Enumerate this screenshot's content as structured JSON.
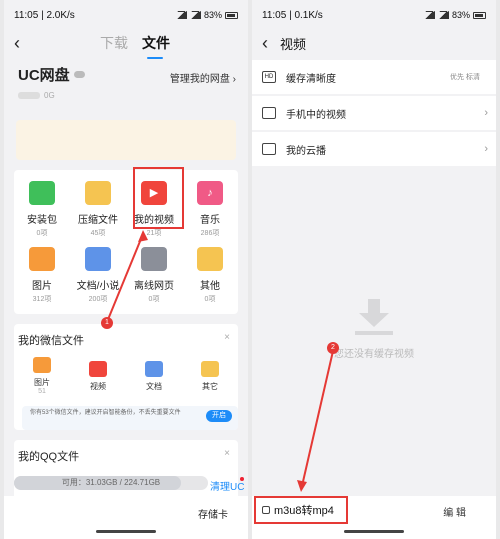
{
  "left": {
    "status": {
      "time": "11:05",
      "speed": "2.0K/s",
      "battery": "83%"
    },
    "tabs": {
      "download": "下载",
      "file": "文件"
    },
    "disk": {
      "title": "UC网盘",
      "used": "0G",
      "manage": "管理我的网盘"
    },
    "files": [
      {
        "label": "安装包",
        "count": "0项",
        "icon": "android-icon",
        "color": "#3fbf5a"
      },
      {
        "label": "压缩文件",
        "count": "45项",
        "icon": "zip-icon",
        "color": "#f5c451"
      },
      {
        "label": "我的视频",
        "count": "21项",
        "icon": "video-icon",
        "color": "#f0453c"
      },
      {
        "label": "音乐",
        "count": "286项",
        "icon": "music-icon",
        "color": "#f05a86"
      },
      {
        "label": "图片",
        "count": "312项",
        "icon": "image-icon",
        "color": "#f69a3a"
      },
      {
        "label": "文档/小说",
        "count": "200项",
        "icon": "document-icon",
        "color": "#5e93e8"
      },
      {
        "label": "离线网页",
        "count": "0项",
        "icon": "globe-icon",
        "color": "#8b8f99"
      },
      {
        "label": "其他",
        "count": "0项",
        "icon": "folder-icon",
        "color": "#f5c451"
      }
    ],
    "wechat": {
      "title": "我的微信文件",
      "items": [
        {
          "label": "图片",
          "count": "51",
          "icon": "image-icon",
          "color": "#f69a3a"
        },
        {
          "label": "视频",
          "count": "",
          "icon": "video-icon",
          "color": "#f0453c"
        },
        {
          "label": "文档",
          "count": "",
          "icon": "document-icon",
          "color": "#5e93e8"
        },
        {
          "label": "其它",
          "count": "",
          "icon": "folder-icon",
          "color": "#f5c451"
        }
      ],
      "tip": "你有53个微信文件，建议开启智能备份，不丢失重要文件",
      "open": "开启"
    },
    "qq": {
      "title": "我的QQ文件"
    },
    "storage": {
      "text": "可用：31.03GB / 224.71GB",
      "used_fraction": 0.86,
      "clean": "清理UC",
      "card": "存储卡"
    }
  },
  "right": {
    "status": {
      "time": "11:05",
      "speed": "0.1K/s",
      "battery": "83%"
    },
    "title": "视频",
    "rows": [
      {
        "label": "缓存清晰度",
        "sub": "优先 标清",
        "icon": "hd-icon",
        "icon_text": "HD"
      },
      {
        "label": "手机中的视频",
        "sub": "",
        "icon": "phone-icon",
        "icon_text": ""
      },
      {
        "label": "我的云播",
        "sub": "",
        "icon": "cloud-play-icon",
        "icon_text": ""
      }
    ],
    "empty": "您还没有缓存视频",
    "convert": "m3u8转mp4",
    "edit": "编 辑"
  },
  "annotations": {
    "badge1": "1",
    "badge2": "2"
  }
}
